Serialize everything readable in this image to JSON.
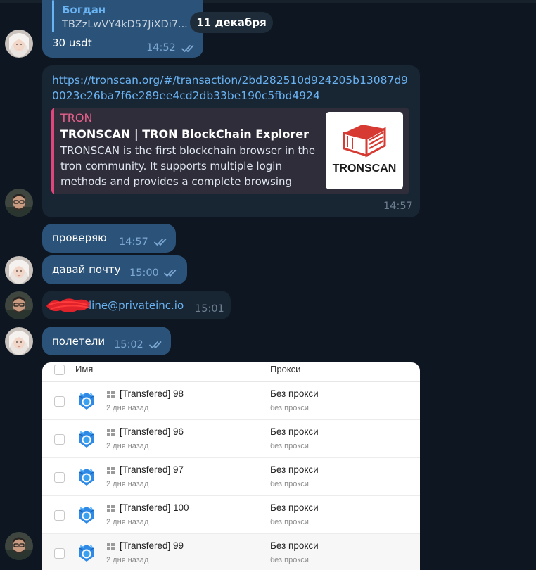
{
  "colors": {
    "background": "#0e1621",
    "outgoing_bubble": "#2b5278",
    "incoming_bubble": "#182533",
    "link": "#6ab3f3",
    "read_check": "#7da8d3",
    "tron_accent": "#e0457b"
  },
  "date_separator": "11 декабря",
  "messages": [
    {
      "reply": {
        "name": "Богдан",
        "text": "TBZzLwVY4kD57JiXDi7..."
      },
      "text": "30 usdt",
      "time": "14:52",
      "status": "read"
    },
    {
      "link": "https://tronscan.org/#/transaction/2bd282510d924205b13087d90023e26ba7f6e289ee4cd2db33be190c5fbd4924",
      "preview": {
        "site": "TRON",
        "title": "TRONSCAN | TRON BlockChain Explorer",
        "description": "TRONSCAN is the first blockchain browser in the tron community. It supports multiple login methods and provides a complete browsing an...",
        "thumb_text": "TRONSCAN"
      },
      "time": "14:57"
    },
    {
      "text": "проверяю",
      "time": "14:57",
      "status": "read"
    },
    {
      "text": "давай почту",
      "time": "15:00",
      "status": "read"
    },
    {
      "text": "line@privateinc.io",
      "time": "15:01"
    },
    {
      "text": "полетели",
      "time": "15:02",
      "status": "read"
    }
  ],
  "table": {
    "col_name": "Имя",
    "col_proxy": "Прокси",
    "rows": [
      {
        "name": "[Transfered] 98",
        "sub": "2 дня назад",
        "proxy": "Без прокси",
        "proxy_sub": "без прокси"
      },
      {
        "name": "[Transfered] 96",
        "sub": "2 дня назад",
        "proxy": "Без прокси",
        "proxy_sub": "без прокси"
      },
      {
        "name": "[Transfered] 97",
        "sub": "2 дня назад",
        "proxy": "Без прокси",
        "proxy_sub": "без прокси"
      },
      {
        "name": "[Transfered] 100",
        "sub": "2 дня назад",
        "proxy": "Без прокси",
        "proxy_sub": "без прокси"
      },
      {
        "name": "[Transfered] 99",
        "sub": "2 дня назад",
        "proxy": "Без прокси",
        "proxy_sub": "без прокси"
      }
    ]
  },
  "icons": {
    "read_status": "double-check-icon",
    "row_logo": "browser-profile-logo-icon",
    "os": "windows-icon",
    "thumb": "tronscan-cube-logo"
  }
}
